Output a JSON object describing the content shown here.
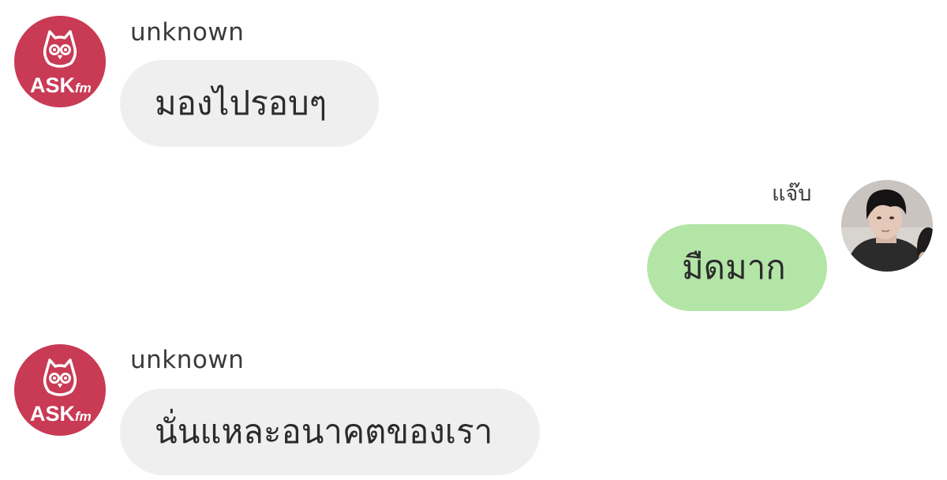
{
  "colors": {
    "askfm_red": "#c93a55",
    "received_bubble": "#efefef",
    "sent_bubble": "#b3e5a7"
  },
  "messages": [
    {
      "sender": "unknown",
      "text": "มองไปรอบๆ",
      "avatar": "askfm-logo",
      "direction": "received"
    },
    {
      "sender": "แจ๊บ",
      "text": "มืดมาก",
      "avatar": "profile-photo",
      "direction": "sent"
    },
    {
      "sender": "unknown",
      "text": "นั่นแหละอนาคตของเรา",
      "avatar": "askfm-logo",
      "direction": "received"
    }
  ],
  "askfm_logo": {
    "wordmark": "ASK",
    "suffix": "fm"
  }
}
